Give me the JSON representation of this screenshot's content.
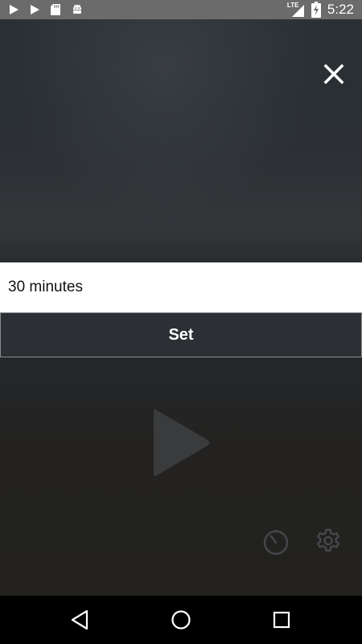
{
  "status_bar": {
    "time": "5:22",
    "network": "LTE",
    "icons": [
      "play-icon",
      "play-icon",
      "sd-card-icon",
      "android-icon",
      "lte-signal-icon",
      "battery-charging-icon"
    ]
  },
  "dialog": {
    "close_icon": "close-icon",
    "duration_value": "30 minutes",
    "set_label": "Set"
  },
  "player": {
    "play_icon": "play-icon",
    "timer_icon": "timer-icon",
    "settings_icon": "gear-icon"
  },
  "nav_bar": {
    "icons": [
      "back-icon",
      "home-icon",
      "recents-icon"
    ]
  },
  "colors": {
    "status_bar_bg": "#6b6b6b",
    "input_bg": "#ffffff",
    "button_bg": "#2c2f33",
    "nav_bar_bg": "#000000"
  }
}
